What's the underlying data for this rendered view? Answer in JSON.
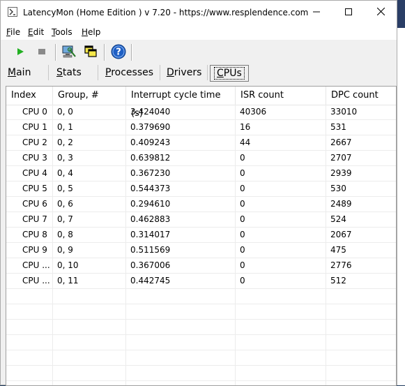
{
  "window": {
    "title": "LatencyMon  (Home Edition )  v 7.20 - https://www.resplendence.com"
  },
  "menu": [
    {
      "label": "File",
      "mnemonic": "F",
      "rest": "ile"
    },
    {
      "label": "Edit",
      "mnemonic": "E",
      "rest": "dit"
    },
    {
      "label": "Tools",
      "mnemonic": "T",
      "rest": "ools"
    },
    {
      "label": "Help",
      "mnemonic": "H",
      "rest": "elp"
    }
  ],
  "toolbar": {
    "icons": [
      "play-icon",
      "stop-icon",
      "computer-wrench-icon",
      "windows-icon",
      "help-icon"
    ],
    "colors": {
      "play": "#22b022",
      "stop": "#8a8a8a",
      "help": "#1f5fc4"
    }
  },
  "tabs": [
    {
      "label": "Main",
      "mnemonic": "M",
      "rest": "ain",
      "active": false
    },
    {
      "label": "Stats",
      "mnemonic": "S",
      "rest": "tats",
      "active": false
    },
    {
      "label": "Processes",
      "mnemonic": "P",
      "rest": "rocesses",
      "active": false
    },
    {
      "label": "Drivers",
      "mnemonic": "D",
      "rest": "rivers",
      "active": false
    },
    {
      "label": "CPUs",
      "mnemonic": "C",
      "rest": "PUs",
      "active": true
    }
  ],
  "table": {
    "columns": [
      "Index",
      "Group, #",
      "Interrupt cycle time (s)",
      "ISR count",
      "DPC count"
    ],
    "rows": [
      [
        "CPU 0",
        "0, 0",
        "3.424040",
        "40306",
        "33010"
      ],
      [
        "CPU 1",
        "0, 1",
        "0.379690",
        "16",
        "531"
      ],
      [
        "CPU 2",
        "0, 2",
        "0.409243",
        "44",
        "2667"
      ],
      [
        "CPU 3",
        "0, 3",
        "0.639812",
        "0",
        "2707"
      ],
      [
        "CPU 4",
        "0, 4",
        "0.367230",
        "0",
        "2939"
      ],
      [
        "CPU 5",
        "0, 5",
        "0.544373",
        "0",
        "530"
      ],
      [
        "CPU 6",
        "0, 6",
        "0.294610",
        "0",
        "2489"
      ],
      [
        "CPU 7",
        "0, 7",
        "0.462883",
        "0",
        "524"
      ],
      [
        "CPU 8",
        "0, 8",
        "0.314017",
        "0",
        "2067"
      ],
      [
        "CPU 9",
        "0, 9",
        "0.511569",
        "0",
        "475"
      ],
      [
        "CPU ...",
        "0, 10",
        "0.367006",
        "0",
        "2776"
      ],
      [
        "CPU ...",
        "0, 11",
        "0.442745",
        "0",
        "512"
      ]
    ],
    "empty_rows": 7
  }
}
